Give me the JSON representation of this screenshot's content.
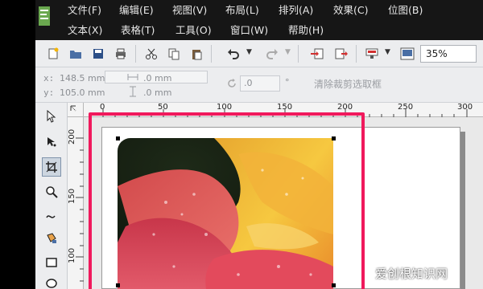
{
  "menu": {
    "row1": [
      "文件(F)",
      "编辑(E)",
      "视图(V)",
      "布局(L)",
      "排列(A)",
      "效果(C)",
      "位图(B)"
    ],
    "row2": [
      "文本(X)",
      "表格(T)",
      "工具(O)",
      "窗口(W)",
      "帮助(H)"
    ]
  },
  "toolbar": {
    "icons": [
      "new-icon",
      "open-icon",
      "save-icon",
      "print-icon",
      "cut-icon",
      "copy-icon",
      "paste-icon",
      "undo-icon",
      "redo-icon",
      "import-icon",
      "export-icon",
      "publish-icon",
      "app-launcher-icon"
    ],
    "zoom": "35%"
  },
  "property_bar": {
    "x_label": "x:",
    "x_value": "148.5 mm",
    "y_label": "y:",
    "y_value": "105.0 mm",
    "w_value": ".0 mm",
    "h_value": ".0 mm",
    "rotation": ".0",
    "degree": "°",
    "clear_crop": "清除裁剪选取框"
  },
  "ruler": {
    "h_ticks": [
      "0",
      "50",
      "100",
      "150",
      "200",
      "250",
      "300"
    ],
    "v_ticks": [
      "200",
      "150",
      "100"
    ]
  },
  "tools": [
    "pick-tool-icon",
    "shape-tool-icon",
    "crop-tool-icon",
    "zoom-tool-icon",
    "freehand-tool-icon",
    "smart-fill-icon",
    "rectangle-tool-icon",
    "ellipse-tool-icon"
  ],
  "colors": {
    "highlight": "#f0195c",
    "menu_bg": "#161616",
    "toolbar_bg": "#ecedef"
  },
  "watermark": "爱创根知识网"
}
